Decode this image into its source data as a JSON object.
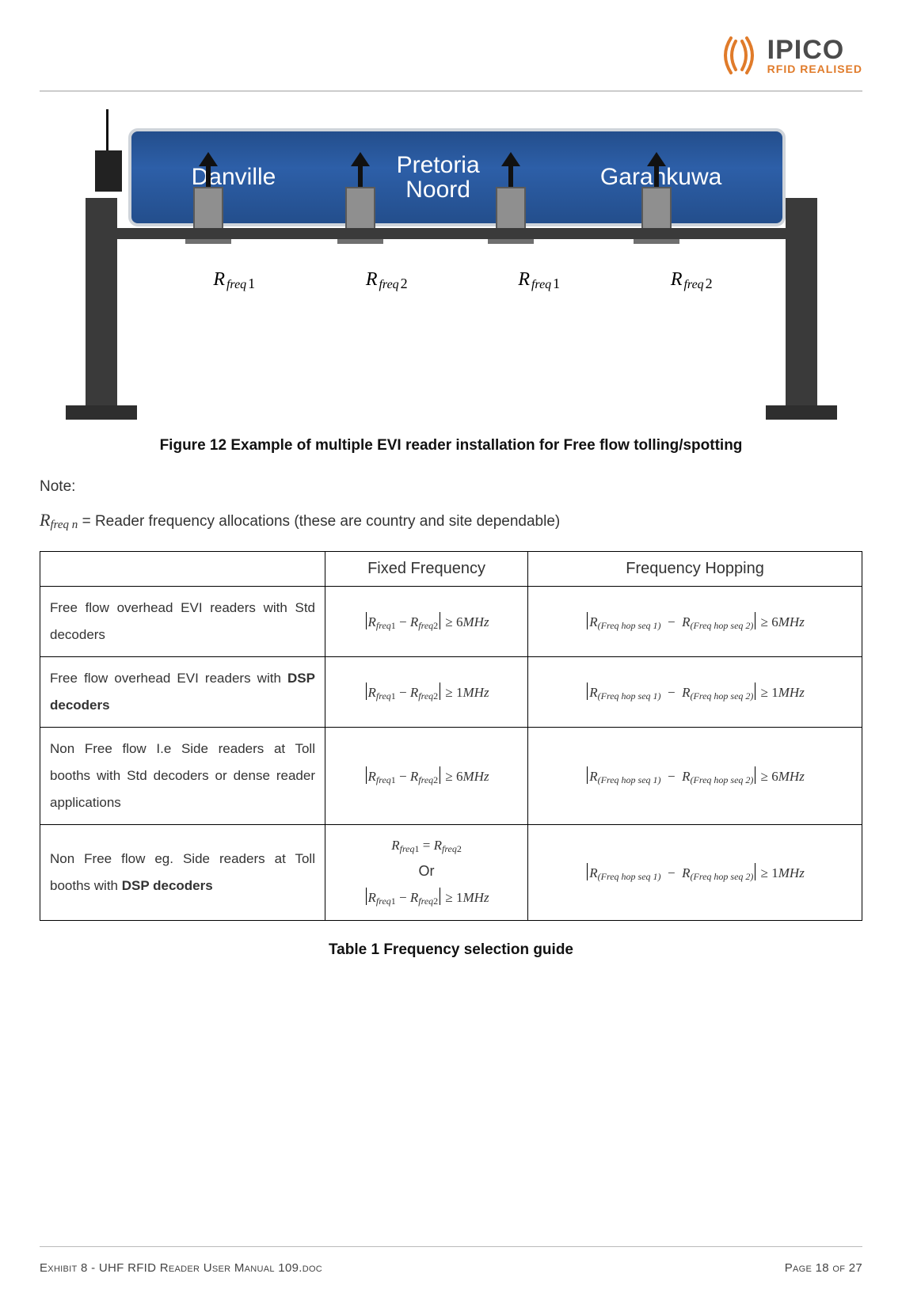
{
  "header": {
    "logo_title": "IPICO",
    "logo_sub": "RFID REALISED"
  },
  "figure": {
    "sign": {
      "dest1": "Danville",
      "dest2_line1": "Pretoria",
      "dest2_line2": "Noord",
      "dest3": "Garankuwa"
    },
    "freq_labels": [
      "R",
      "freq",
      "1",
      "R",
      "freq",
      "2",
      "R",
      "freq",
      "1",
      "R",
      "freq",
      "2"
    ],
    "caption": "Figure 12 Example of multiple EVI reader installation for Free flow tolling/spotting"
  },
  "note": {
    "label": "Note:",
    "symbol_R": "R",
    "symbol_sub": "freq n",
    "text": " = Reader frequency allocations (these are country and site dependable)"
  },
  "table": {
    "headers": [
      "",
      "Fixed Frequency",
      "Frequency Hopping"
    ],
    "rows": [
      {
        "desc_plain": "Free flow overhead EVI readers with Std decoders",
        "desc_bold": "",
        "fixed_value": "6",
        "hop_value": "6"
      },
      {
        "desc_plain": "Free flow overhead EVI readers with ",
        "desc_bold": "DSP decoders",
        "fixed_value": "1",
        "hop_value": "1"
      },
      {
        "desc_plain": "Non Free flow I.e Side readers at Toll booths with Std decoders  or dense reader applications",
        "desc_bold": "",
        "fixed_value": "6",
        "hop_value": "6"
      },
      {
        "desc_plain": "Non Free flow eg. Side readers at Toll booths with ",
        "desc_bold": "DSP decoders",
        "fixed_eq": true,
        "fixed_or": "Or",
        "fixed_value": "1",
        "hop_value": "1"
      }
    ],
    "math": {
      "R": "R",
      "freq": "freq",
      "one": "1",
      "two": "2",
      "hop1": "(Freq hop seq 1)",
      "hop2": "(Freq hop seq 2)",
      "ge": "≥",
      "minus": "−",
      "eq": "=",
      "mhz": "MHz"
    },
    "caption": "Table 1 Frequency selection guide"
  },
  "footer": {
    "left": "Exhibit 8 - UHF RFID Reader User Manual 109.doc",
    "right_prefix": "Page ",
    "page_cur": "18",
    "right_mid": " of ",
    "page_total": "27"
  }
}
